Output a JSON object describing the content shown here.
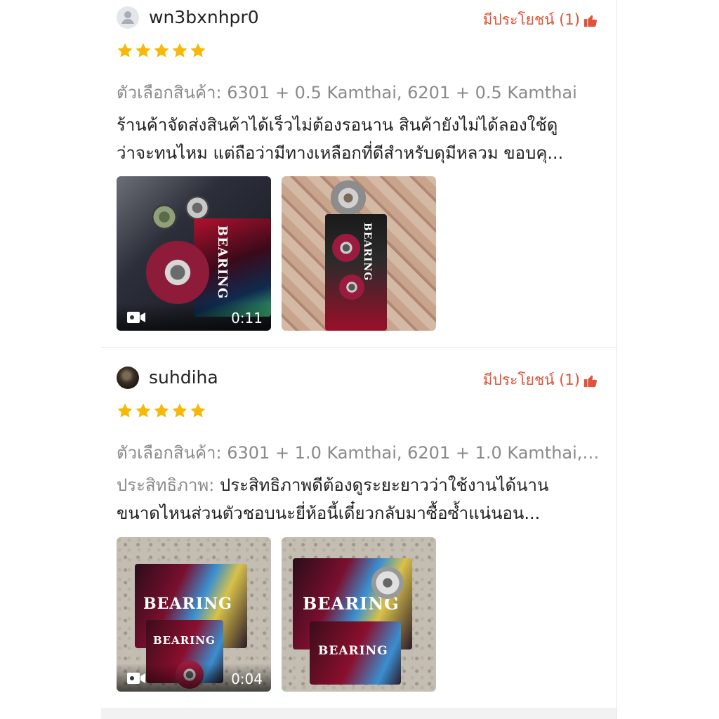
{
  "reviews": [
    {
      "username": "wn3bxnhpr0",
      "helpful_label": "มีประโยชน์ (1)",
      "rating": 5,
      "variant_label": "ตัวเลือกสินค้า:",
      "variant_value": "6301 + 0.5 Kamthai, 6201 + 0.5 Kamthai",
      "text_prefix": "",
      "text_line1": "ร้านค้าจัดส่งสินค้าได้เร็วไม่ต้องรอนาน  สินค้ายังไม่ได้ลองใช้ดู",
      "text_line2": "ว่าจะทนไหม แต่ถือว่ามีทางเหลือกที่ดีสำหรับดุมีหลวม  ขอบคุ...",
      "media": [
        {
          "type": "video",
          "duration": "0:11",
          "box_label": "BEARING"
        },
        {
          "type": "image",
          "box_label": "BEARING"
        }
      ]
    },
    {
      "username": "suhdiha",
      "helpful_label": "มีประโยชน์ (1)",
      "rating": 5,
      "variant_label": "ตัวเลือกสินค้า:",
      "variant_value": "6301 + 1.0 Kamthai, 6201 + 1.0 Kamthai, 6...",
      "text_prefix": "ประสิทธิภาพ:",
      "text_line1": "ประสิทธิภาพดีต้องดูระยะยาวว่าใช้งานได้นาน",
      "text_line2": "ขนาดไหนส่วนตัวชอบนะยี่ห้อนี้เดี๋ยวกลับมาซื้อซ้ำแน่นอน...",
      "media": [
        {
          "type": "video",
          "duration": "0:04",
          "box_label": "BEARING"
        },
        {
          "type": "image",
          "box_label": "BEARING"
        }
      ]
    }
  ],
  "colors": {
    "star": "#f6b90b",
    "helpful": "#e0533a",
    "muted_text": "#8a8a8a"
  },
  "icons": {
    "avatar_default": "person-icon",
    "helpful": "thumbs-up-icon",
    "video": "video-camera-icon",
    "star": "star-icon"
  }
}
